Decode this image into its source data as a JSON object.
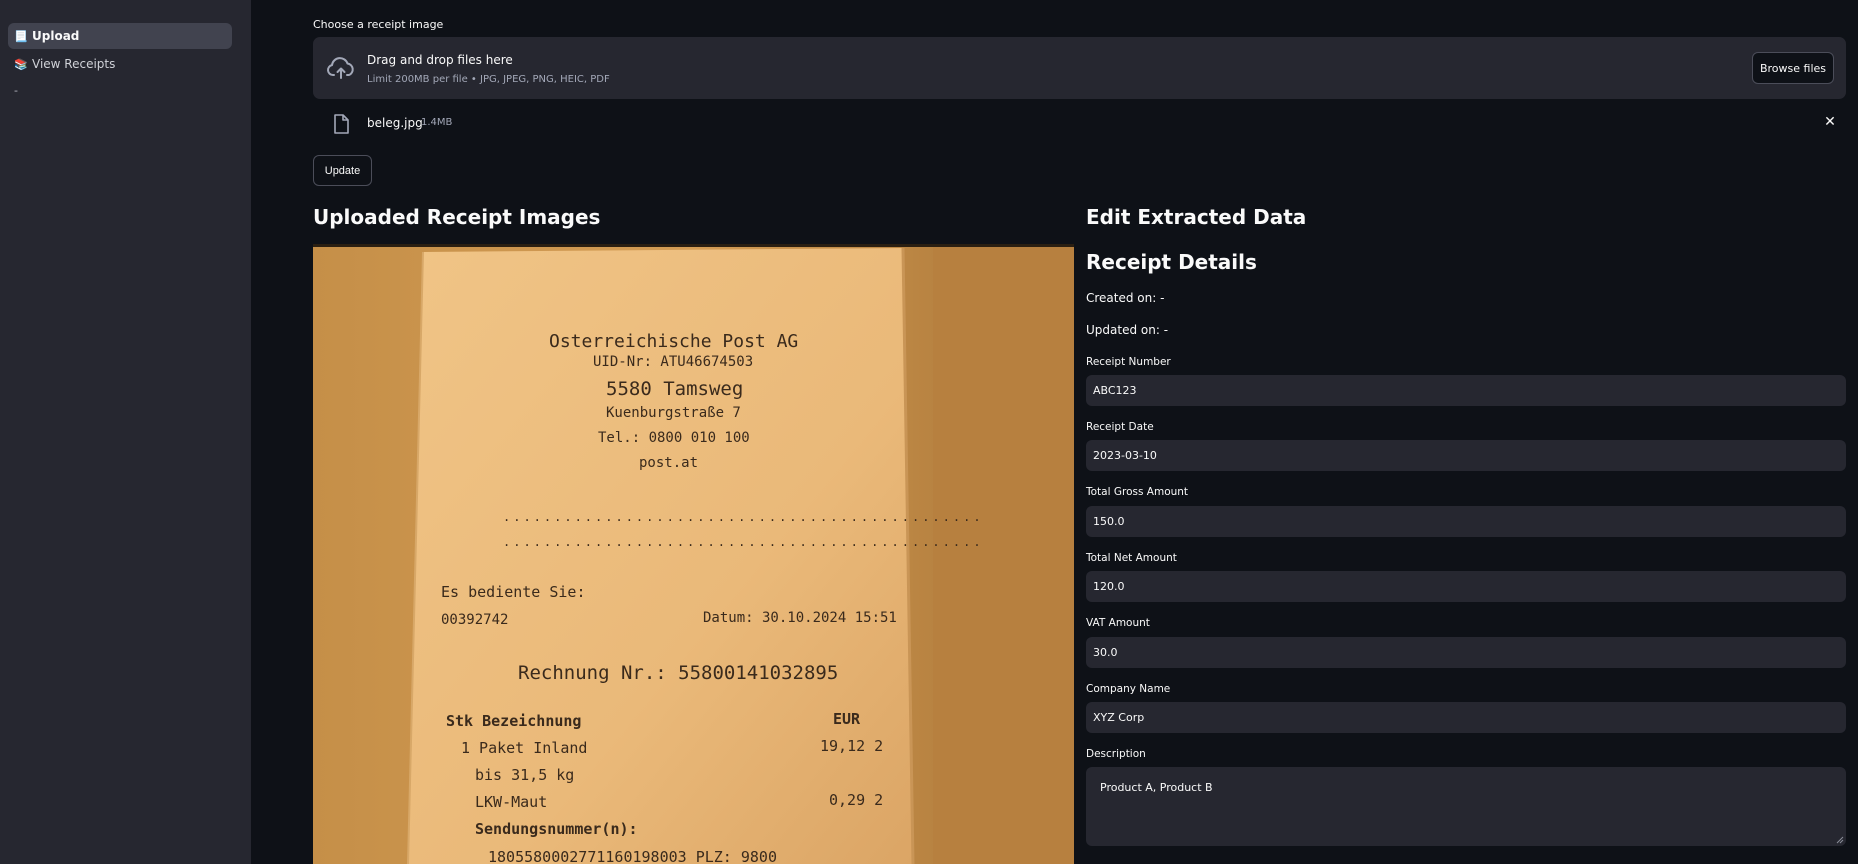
{
  "sidebar": {
    "items": [
      {
        "emoji": "📃",
        "label": "Upload",
        "active": true
      },
      {
        "emoji": "📚",
        "label": "View Receipts",
        "active": false
      }
    ],
    "trailing": "-"
  },
  "uploader": {
    "label": "Choose a receipt image",
    "drop_title": "Drag and drop files here",
    "drop_subtitle": "Limit 200MB per file • JPG, JPEG, PNG, HEIC, PDF",
    "browse_label": "Browse files",
    "file": {
      "name": "beleg.jpg",
      "size": "1.4MB"
    }
  },
  "update_label": "Update",
  "left_heading": "Uploaded Receipt Images",
  "receipt_image_text": {
    "company": "Osterreichische Post AG",
    "uid": "UID-Nr: ATU46674503",
    "city": "5580 Tamsweg",
    "street": "Kuenburgstraße 7",
    "tel": "Tel.: 0800 010 100",
    "web": "post.at",
    "served": "Es bediente Sie:",
    "staff": "00392742",
    "date": "Datum: 30.10.2024 15:51",
    "invoice": "Rechnung Nr.: 55800141032895",
    "col1": "Stk Bezeichnung",
    "col2": "EUR",
    "item1": "1 Paket Inland",
    "item1_price": "19,12 2",
    "item1_sub": "bis 31,5 kg",
    "item2": "LKW-Maut",
    "item2_price": "0,29 2",
    "shipment": "Sendungsnummer(n):",
    "shipment_no": "1805580002771160198003  PLZ: 9800"
  },
  "right": {
    "heading": "Edit Extracted Data",
    "subheading": "Receipt Details",
    "created": "Created on: -",
    "updated": "Updated on: -",
    "fields": [
      {
        "label": "Receipt Number",
        "value": "ABC123"
      },
      {
        "label": "Receipt Date",
        "value": "2023-03-10"
      },
      {
        "label": "Total Gross Amount",
        "value": "150.0"
      },
      {
        "label": "Total Net Amount",
        "value": "120.0"
      },
      {
        "label": "VAT Amount",
        "value": "30.0"
      },
      {
        "label": "Company Name",
        "value": "XYZ Corp"
      }
    ],
    "description": {
      "label": "Description",
      "value": "Product A, Product B"
    }
  },
  "colors": {
    "background": "#0e1117",
    "sidebar": "#262730",
    "input": "#262730",
    "text": "#fafafa"
  }
}
